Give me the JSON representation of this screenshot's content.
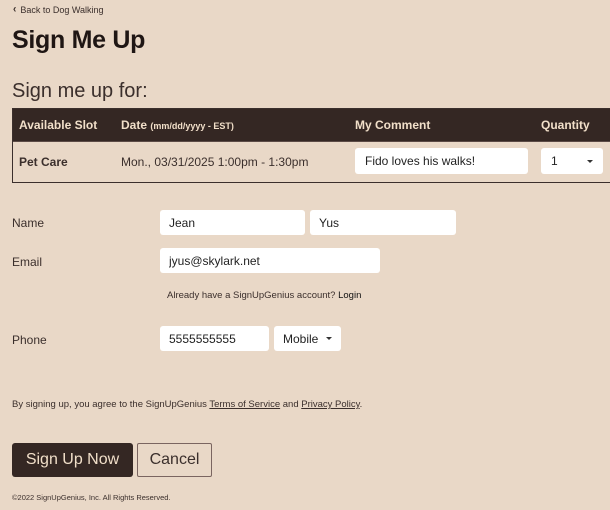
{
  "nav": {
    "back_icon": "chevron-left-icon",
    "back_label": "Back to Dog Walking"
  },
  "header": {
    "title": "Sign Me Up"
  },
  "section": {
    "title": "Sign me up for:"
  },
  "table": {
    "columns": [
      {
        "label": "Available Slot",
        "hint": ""
      },
      {
        "label": "Date",
        "hint": "(mm/dd/yyyy - EST)"
      },
      {
        "label": "My Comment",
        "hint": ""
      },
      {
        "label": "Quantity",
        "hint": ""
      }
    ],
    "rows": [
      {
        "slot": "Pet Care",
        "date": "Mon., 03/31/2025 1:00pm - 1:30pm",
        "comment": "Fido loves his walks!",
        "quantity": "1"
      }
    ]
  },
  "form": {
    "name_label": "Name",
    "first_name": "Jean",
    "last_name": "Yus",
    "email_label": "Email",
    "email": "jyus@skylark.net",
    "login_hint": "Already have a SignUpGenius account?",
    "login_link": "Login",
    "phone_label": "Phone",
    "phone": "5555555555",
    "phone_type": "Mobile"
  },
  "terms": {
    "prefix": "By signing up, you agree to the SignUpGenius",
    "terms_link": "Terms of Service",
    "and": "and",
    "privacy_link": "Privacy Policy",
    "suffix": "."
  },
  "actions": {
    "submit_label": "Sign Up Now",
    "cancel_label": "Cancel"
  },
  "footer": {
    "copyright": "©2022 SignUpGenius, Inc. All Rights Reserved."
  },
  "colors": {
    "background": "#e9d8c7",
    "header_bg": "#342723",
    "header_text": "#f1dfc9",
    "text": "#3b2f2c"
  }
}
